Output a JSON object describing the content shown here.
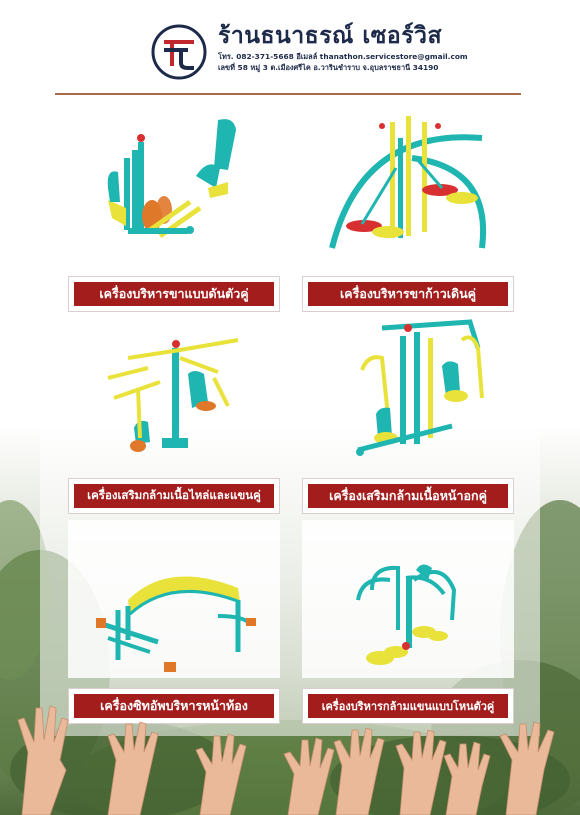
{
  "header": {
    "shop_name": "ร้านธนาธรณ์ เซอร์วิส",
    "contact_line1": "โทร. 082-371-5668 อีเมลล์ thanathon.servicestore@gmail.com",
    "contact_line2": "เลขที่ 58 หมู่ 3 ต.เมืองศรีไค อ.วารินชำราบ จ.อุบลราชธานี 34190",
    "logo_icon": "tt-monogram-logo"
  },
  "colors": {
    "label_bg": "#a31d1d",
    "navy": "#1e2a4a",
    "equipment_teal": "#1fb5b0",
    "equipment_yellow": "#e8e23a",
    "accent_red": "#d83030",
    "accent_orange": "#e0782a"
  },
  "products": [
    {
      "label": "เครื่องบริหารขาแบบดันตัวคู่",
      "icon": "double-leg-press-equipment"
    },
    {
      "label": "เครื่องบริหารขาก้าวเดินคู่",
      "icon": "double-air-walker-equipment"
    },
    {
      "label": "เครื่องเสริมกล้ามเนื้อไหล่และแขนคู่",
      "icon": "shoulder-arm-press-equipment"
    },
    {
      "label": "เครื่องเสริมกล้ามเนื้อหน้าอกคู่",
      "icon": "chest-press-equipment"
    },
    {
      "label": "เครื่องซิทอัพบริหารหน้าท้อง",
      "icon": "sit-up-bench-equipment"
    },
    {
      "label": "เครื่องบริหารกล้ามแขนแบบโหนตัวคู่",
      "icon": "arm-swing-equipment"
    }
  ]
}
